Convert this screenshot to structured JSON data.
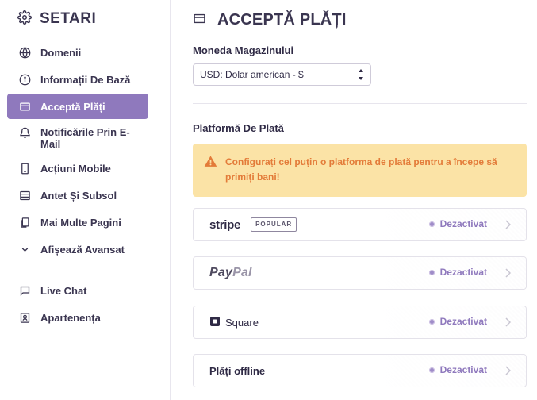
{
  "sidebar": {
    "title": "SETARI",
    "items": [
      {
        "label": "Domenii",
        "icon": "globe-icon",
        "active": false
      },
      {
        "label": "Informații De Bază",
        "icon": "info-icon",
        "active": false
      },
      {
        "label": "Acceptă Plăți",
        "icon": "wallet-icon",
        "active": true
      },
      {
        "label": "Notificările Prin E-Mail",
        "icon": "bell-icon",
        "active": false
      },
      {
        "label": "Acțiuni Mobile",
        "icon": "phone-icon",
        "active": false
      },
      {
        "label": "Antet Și Subsol",
        "icon": "layout-icon",
        "active": false
      },
      {
        "label": "Mai Multe Pagini",
        "icon": "pages-icon",
        "active": false
      },
      {
        "label": "Afișează Avansat",
        "icon": "chevron-down-icon",
        "active": false
      },
      {
        "label": "Live Chat",
        "icon": "chat-icon",
        "active": false
      },
      {
        "label": "Apartenența",
        "icon": "user-card-icon",
        "active": false
      }
    ]
  },
  "main": {
    "title": "ACCEPTĂ PLĂȚI",
    "currency": {
      "label": "Moneda Magazinului",
      "selected": "USD: Dolar american - $"
    },
    "platform_label": "Platformă De Plată",
    "warning": "Configurați cel puțin o platforma de plată pentru a începe să primiți bani!",
    "providers": [
      {
        "name": "stripe",
        "badge": "POPULAR",
        "status": "Dezactivat"
      },
      {
        "name": "PayPal",
        "name_pay": "Pay",
        "name_pal": "Pal",
        "status": "Dezactivat"
      },
      {
        "name": "Square",
        "status": "Dezactivat"
      },
      {
        "name": "Plăți offline",
        "status": "Dezactivat"
      }
    ]
  },
  "colors": {
    "active": "#8f79bd",
    "warning_bg": "#fbe3a6",
    "warning_text": "#e37b39",
    "status": "#8f79bd"
  }
}
